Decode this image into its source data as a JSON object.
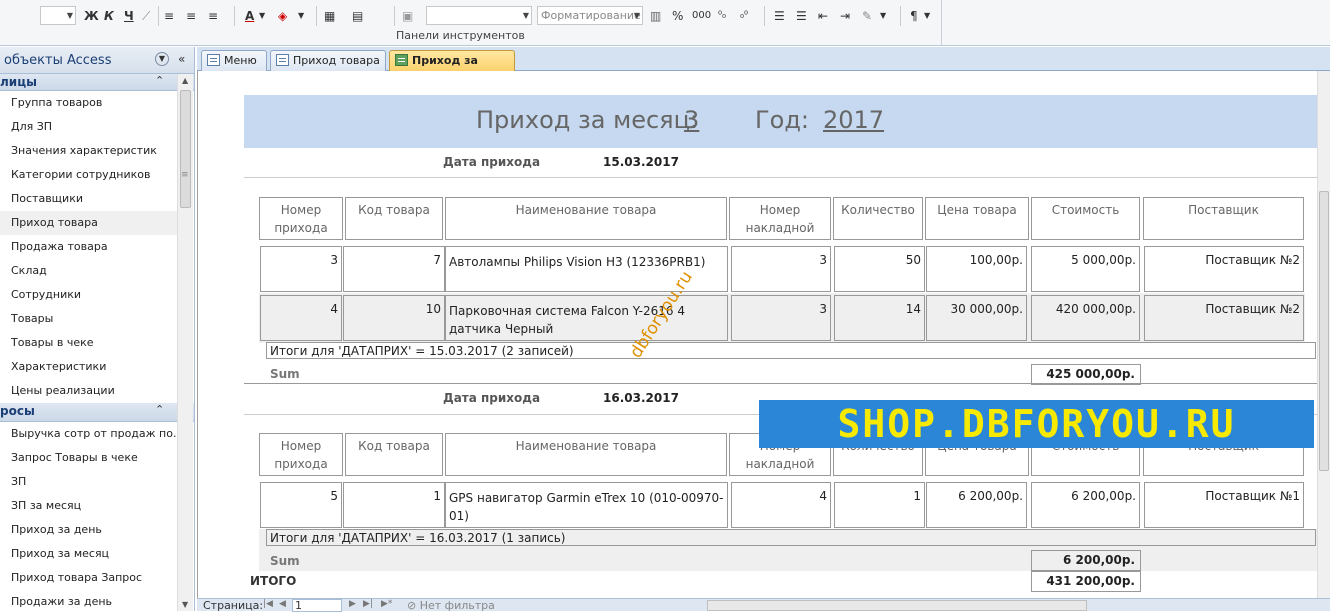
{
  "ribbon": {
    "format_combo": "Форматирование",
    "group_label": "Панели инструментов",
    "bold_btn": "Ж",
    "italic_btn": "К",
    "underline_btn": "Ч",
    "font_color_btn": "A",
    "percent_btn": "%",
    "thousands_btn": "000",
    "paragraph_btn": "¶"
  },
  "nav": {
    "title": "объекты Access",
    "tables_group": "лицы",
    "queries_group": "росы",
    "tables": [
      "Группа товаров",
      "Для ЗП",
      "Значения характеристик",
      "Категории сотрудников",
      "Поставщики",
      "Приход товара",
      "Продажа товара",
      "Склад",
      "Сотрудники",
      "Товары",
      "Товары в чеке",
      "Характеристики",
      "Цены реализации"
    ],
    "queries": [
      "Выручка сотр от продаж по...",
      "Запрос Товары в чеке",
      "ЗП",
      "ЗП за месяц",
      "Приход за день",
      "Приход за месяц",
      "Приход товара Запрос",
      "Продажи за день"
    ]
  },
  "tabs": [
    "Меню",
    "Приход товара",
    "Приход за месяц"
  ],
  "report": {
    "title_month_label": "Приход за месяц:",
    "month": "3",
    "year_label": "Год:",
    "year": "2017",
    "date_label": "Дата прихода",
    "columns": [
      "Номер прихода",
      "Код товара",
      "Наименование товара",
      "Номер накладной",
      "Количество",
      "Цена товара",
      "Стоимость",
      "Поставщик"
    ],
    "groups": [
      {
        "date": "15.03.2017",
        "rows": [
          {
            "num": "3",
            "code": "7",
            "name": "Автолампы Philips Vision H3 (12336PRB1)",
            "invoice": "3",
            "qty": "50",
            "price": "100,00р.",
            "cost": "5 000,00р.",
            "supplier": "Поставщик №2"
          },
          {
            "num": "4",
            "code": "10",
            "name": "Парковочная система Falcon Y-2616 4 датчика Черный",
            "invoice": "3",
            "qty": "14",
            "price": "30 000,00р.",
            "cost": "420 000,00р.",
            "supplier": "Поставщик №2"
          }
        ],
        "summary": "Итоги для 'ДАТАПРИХ' =  15.03.2017 (2 записей)",
        "sum_label": "Sum",
        "sum": "425 000,00р."
      },
      {
        "date": "16.03.2017",
        "rows": [
          {
            "num": "5",
            "code": "1",
            "name": "GPS навигатор Garmin eTrex 10 (010-00970-01)",
            "invoice": "4",
            "qty": "1",
            "price": "6 200,00р.",
            "cost": "6 200,00р.",
            "supplier": "Поставщик №1"
          }
        ],
        "summary": "Итоги для 'ДАТАПРИХ' =  16.03.2017 (1 запись)",
        "sum_label": "Sum",
        "sum": "6 200,00р."
      }
    ],
    "total_label": "ИТОГО",
    "total": "431 200,00р."
  },
  "overlays": {
    "watermark": "dbforyou.ru",
    "banner": "SHOP.DBFORYOU.RU"
  },
  "statusbar": {
    "page_label": "Страница:",
    "page": "1",
    "filter_label": "Нет фильтра"
  },
  "colors": {
    "header_band": "#c6d9f0",
    "active_tab": "#fbd26d",
    "banner_bg": "#2c86d8",
    "banner_text": "#f7ea00"
  }
}
